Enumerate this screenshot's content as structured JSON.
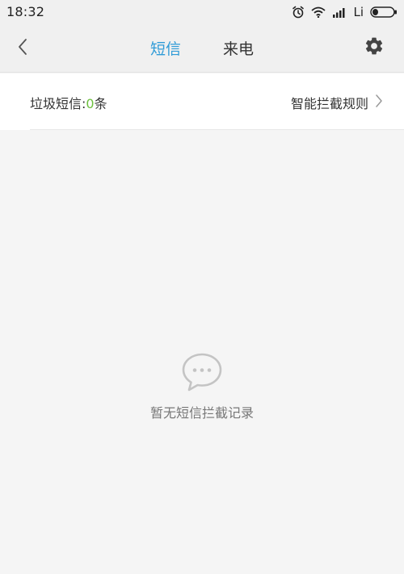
{
  "status_bar": {
    "time": "18:32",
    "carrier": "Li",
    "icons": [
      "alarm-icon",
      "wifi-icon",
      "signal-icon",
      "battery-icon"
    ]
  },
  "header": {
    "tabs": [
      {
        "label": "短信",
        "active": true
      },
      {
        "label": "来电",
        "active": false
      }
    ],
    "accent_color": "#2f9bd7"
  },
  "spam_row": {
    "label_prefix": "垃圾短信:",
    "count": "0",
    "label_suffix": "条",
    "count_color": "#6cbf3e",
    "rules_link": "智能拦截规则"
  },
  "empty_state": {
    "icon": "chat-bubble-icon",
    "message": "暂无短信拦截记录"
  }
}
